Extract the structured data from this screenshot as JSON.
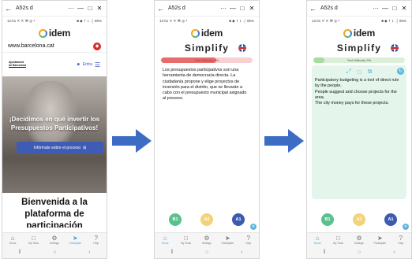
{
  "window": {
    "title": "A52s d",
    "more": "···",
    "minimize": "—",
    "maximize": "□",
    "close": "✕"
  },
  "statusbar": {
    "time_left": "12:01 ✕ ✕ ⌘ ◎ •",
    "right": "■ ◆ ↿⇂ .│ 85%"
  },
  "brand": {
    "name": "idem"
  },
  "phone1": {
    "url": "www.barcelona.cat",
    "site_logo": "Ajuntament de Barcelona",
    "login_label": "Entra",
    "headline": "¡Decidimos en qué invertir los Presupuestos Participativos!",
    "cta_label": "Infórmate sobre el proceso",
    "welcome": "Bienvenida a la plataforma de participación"
  },
  "simplify": {
    "title": "Simplify"
  },
  "phone2": {
    "progress_label": "Text Difficulty 9%",
    "progress_fraction": 0.6,
    "text": "Los presupuestos participativos son una herramienta de democracia directa. La ciudadanía propone y elige proyectos de inversión para el distrito, que se llevarán a cabo con el presupuesto municipal asignado al proceso."
  },
  "phone3": {
    "progress_label": "Text Difficulty 9%",
    "progress_fraction": 0.12,
    "lines": [
      "Participatory budgeting is a tool of direct rule by the people.",
      "People suggest and choose projects for the area.",
      "The city money pays for these projects."
    ]
  },
  "levels": [
    "B1",
    "A2",
    "A1"
  ],
  "nav": {
    "home": "Home",
    "my_texts": "My Texts",
    "settings": "Settings",
    "participate": "Participate",
    "help": "Help"
  },
  "colors": {
    "accent_blue": "#4b9fd6",
    "level_b1": "#5ac18e",
    "level_a2": "#f4d27a",
    "level_a1": "#3b5ab0",
    "difficulty_red": "#e86c6c",
    "difficulty_green": "#a7dca0",
    "arrow": "#3d6cc4"
  },
  "icons": {
    "back": "arrow-left-icon",
    "flag": "uk-flag-icon",
    "expand": "expand-icon",
    "copy": "copy-icon",
    "share": "share-icon",
    "refresh": "refresh-icon",
    "home": "home-icon",
    "texts": "document-icon",
    "settings": "gear-icon",
    "participate": "send-icon",
    "help": "help-icon"
  }
}
